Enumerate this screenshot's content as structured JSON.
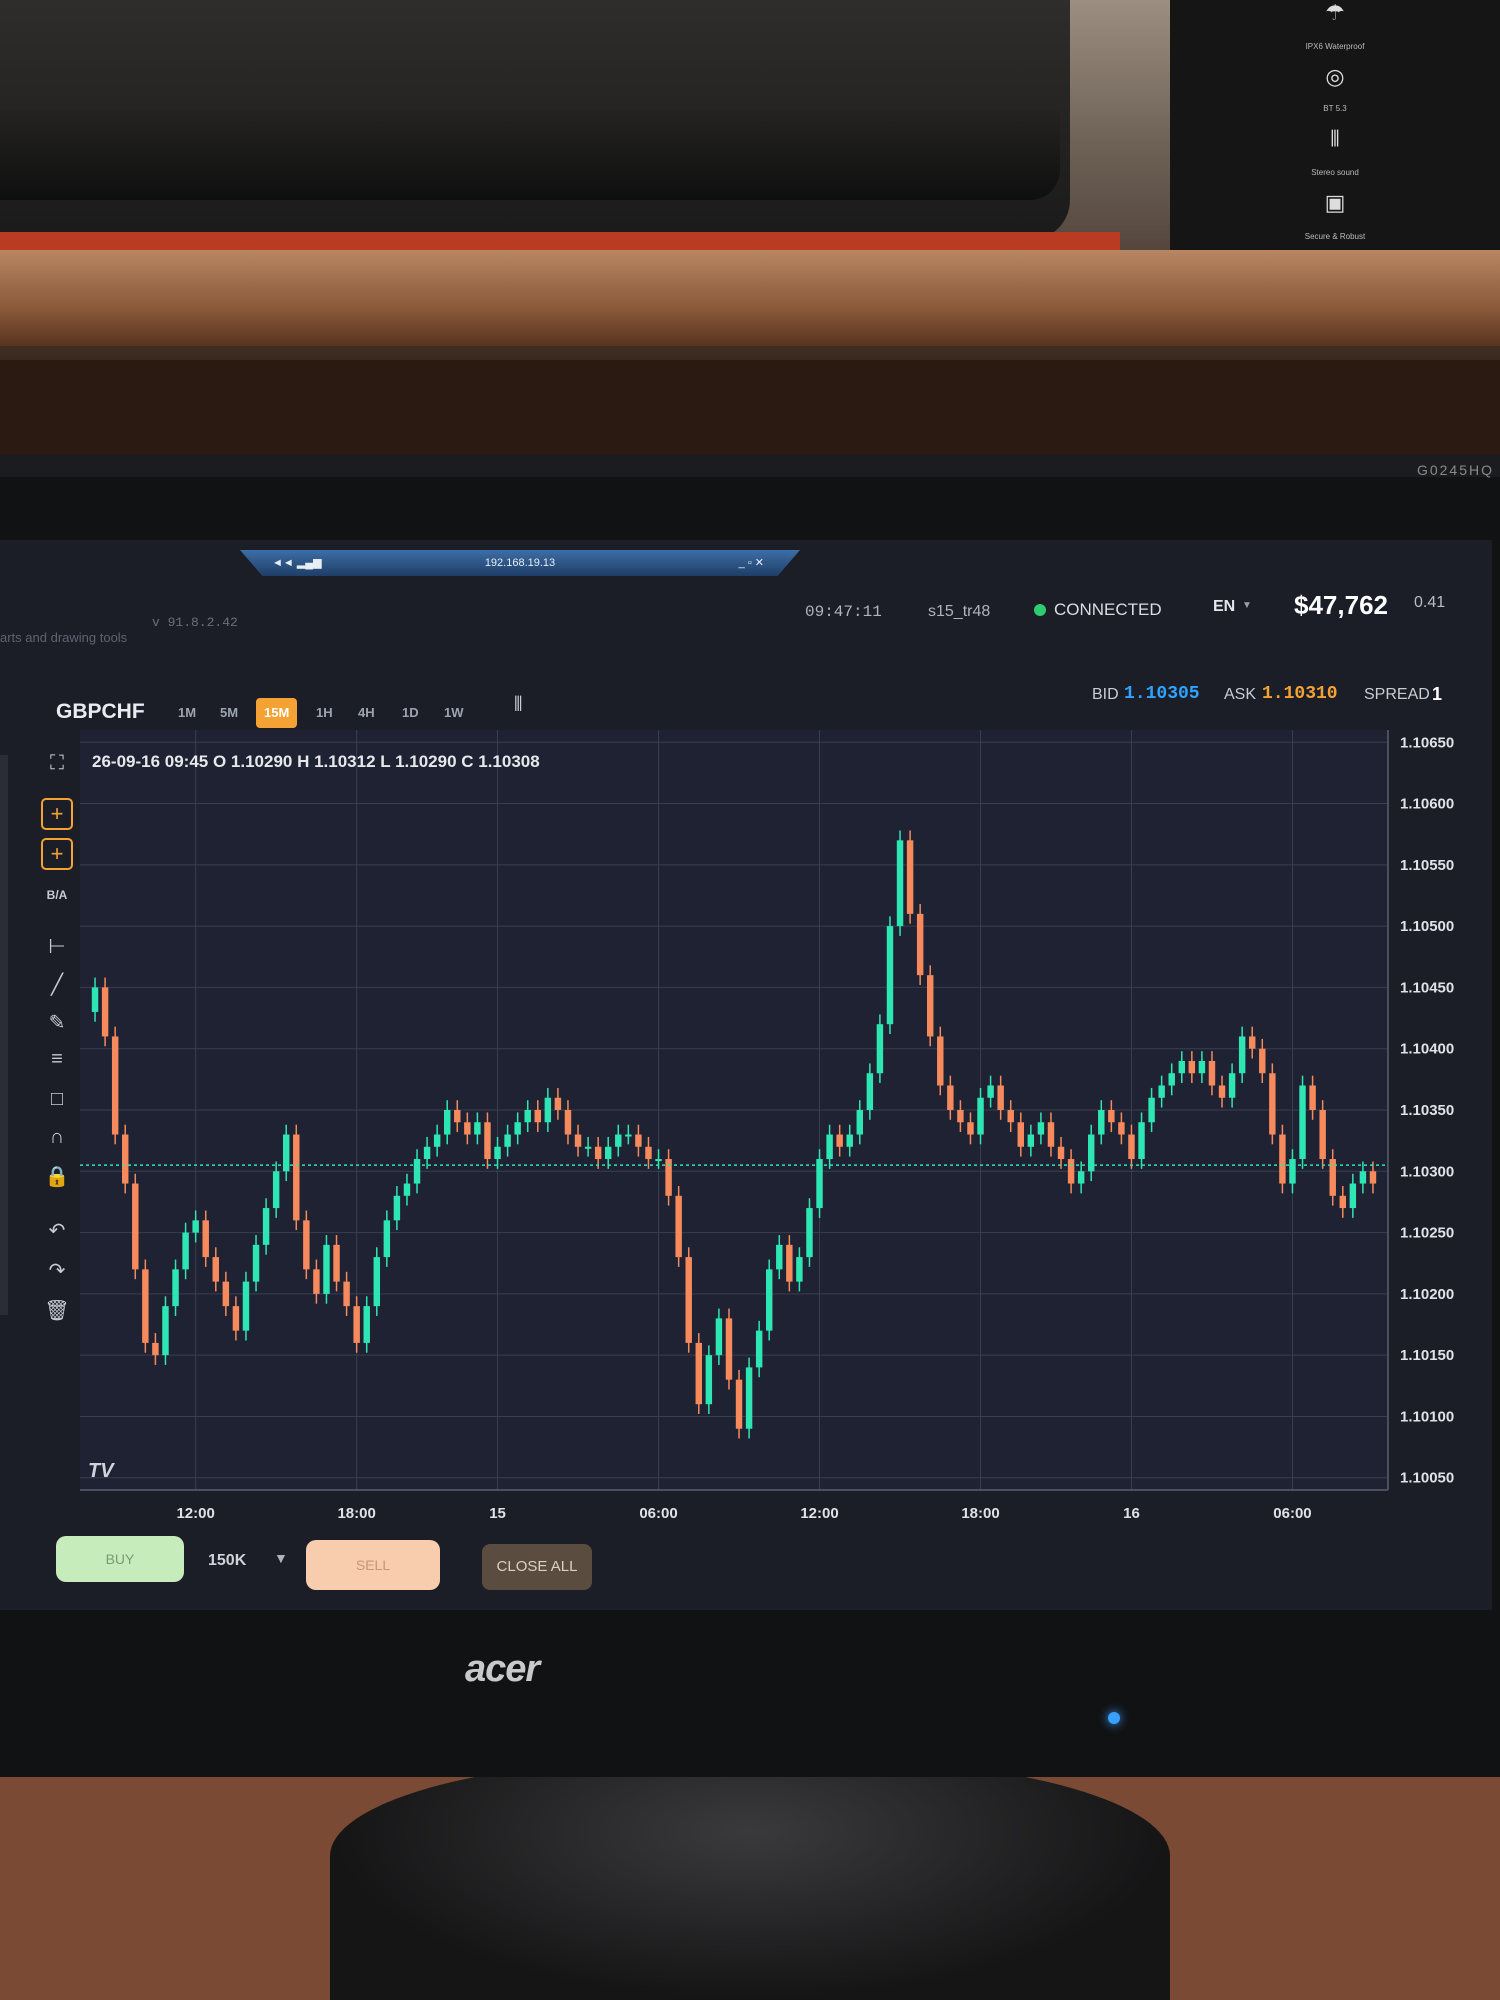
{
  "room": {
    "box_labels": [
      "IPX6 Waterproof",
      "BT 5.3",
      "Stereo sound",
      "Secure & Robust"
    ],
    "monitor_model": "G0245HQ",
    "monitor_brand": "acer"
  },
  "rdp_bar": {
    "title": "192.168.19.13",
    "left_icons": "◄◄ ▂▄▆",
    "window_icons": "_ ▫ ✕"
  },
  "header": {
    "version": "v 91.8.2.42",
    "hint": "arts and drawing tools",
    "time": "09:47:11",
    "account": "s15_tr48",
    "connection": "CONNECTED",
    "language": "EN",
    "balance": "$47,762",
    "balance_change": "0.41",
    "colors": {
      "connected": "#2ecc71",
      "accent": "#f5a235",
      "bid": "#2fa4ff"
    }
  },
  "instrument": {
    "symbol": "GBPCHF",
    "timeframes": [
      "1M",
      "5M",
      "15M",
      "1H",
      "4H",
      "1D",
      "1W"
    ],
    "active_timeframe": "15M",
    "chart_type_icon": "candlestick-icon",
    "bid_label": "BID",
    "bid": "1.10305",
    "ask_label": "ASK",
    "ask": "1.10310",
    "spread_label": "SPREAD",
    "spread": "1"
  },
  "ohlc_line": "26-09-16 09:45 O 1.10290 H 1.10312 L 1.10290 C 1.10308",
  "toolbar": [
    {
      "name": "fullscreen-icon",
      "glyph": "⛶"
    },
    {
      "name": "crosshair-icon",
      "glyph": "+"
    },
    {
      "name": "move-icon",
      "glyph": "+"
    },
    {
      "name": "bid-ask-toggle",
      "glyph": "B/A"
    },
    {
      "name": "horizontal-line-icon",
      "glyph": "⊢"
    },
    {
      "name": "trend-line-icon",
      "glyph": "╱"
    },
    {
      "name": "brush-icon",
      "glyph": "✎"
    },
    {
      "name": "fib-levels-icon",
      "glyph": "≡"
    },
    {
      "name": "rectangle-icon",
      "glyph": "□"
    },
    {
      "name": "magnet-icon",
      "glyph": "∩"
    },
    {
      "name": "lock-icon",
      "glyph": "🔒"
    },
    {
      "name": "undo-icon",
      "glyph": "↶"
    },
    {
      "name": "redo-icon",
      "glyph": "↷"
    },
    {
      "name": "trash-icon",
      "glyph": "🗑"
    }
  ],
  "chart_data": {
    "type": "candlestick",
    "colors": {
      "up": "#2ee6b4",
      "down": "#f68a5c",
      "grid": "#3a3f4f",
      "current_line": "#2ee6b4"
    },
    "x_tick_labels": [
      "12:00",
      "18:00",
      "15",
      "06:00",
      "12:00",
      "18:00",
      "16",
      "06:00"
    ],
    "y_tick_labels": [
      "1.10650",
      "1.10600",
      "1.10550",
      "1.10500",
      "1.10450",
      "1.10400",
      "1.10350",
      "1.10300",
      "1.10250",
      "1.10200",
      "1.10150",
      "1.10100",
      "1.10050"
    ],
    "ylim": [
      1.1004,
      1.1066
    ],
    "current_price": 1.10305,
    "closes": [
      1.1045,
      1.1041,
      1.1033,
      1.1029,
      1.1022,
      1.1016,
      1.1015,
      1.1019,
      1.1022,
      1.1025,
      1.1026,
      1.1023,
      1.1021,
      1.1019,
      1.1017,
      1.1021,
      1.1024,
      1.1027,
      1.103,
      1.1033,
      1.1026,
      1.1022,
      1.102,
      1.1024,
      1.1021,
      1.1019,
      1.1016,
      1.1019,
      1.1023,
      1.1026,
      1.1028,
      1.1029,
      1.1031,
      1.1032,
      1.1033,
      1.1035,
      1.1034,
      1.1033,
      1.1034,
      1.1031,
      1.1032,
      1.1033,
      1.1034,
      1.1035,
      1.1034,
      1.1036,
      1.1035,
      1.1033,
      1.1032,
      1.1032,
      1.1031,
      1.1032,
      1.1033,
      1.1033,
      1.1032,
      1.1031,
      1.1031,
      1.1028,
      1.1023,
      1.1016,
      1.1011,
      1.1015,
      1.1018,
      1.1013,
      1.1009,
      1.1014,
      1.1017,
      1.1022,
      1.1024,
      1.1021,
      1.1023,
      1.1027,
      1.1031,
      1.1033,
      1.1032,
      1.1033,
      1.1035,
      1.1038,
      1.1042,
      1.105,
      1.1057,
      1.1051,
      1.1046,
      1.1041,
      1.1037,
      1.1035,
      1.1034,
      1.1033,
      1.1036,
      1.1037,
      1.1035,
      1.1034,
      1.1032,
      1.1033,
      1.1034,
      1.1032,
      1.1031,
      1.1029,
      1.103,
      1.1033,
      1.1035,
      1.1034,
      1.1033,
      1.1031,
      1.1034,
      1.1036,
      1.1037,
      1.1038,
      1.1039,
      1.1038,
      1.1039,
      1.1037,
      1.1036,
      1.1038,
      1.1041,
      1.104,
      1.1038,
      1.1033,
      1.1029,
      1.1031,
      1.1037,
      1.1035,
      1.1031,
      1.1028,
      1.1027,
      1.1029,
      1.103,
      1.1029
    ]
  },
  "order_bar": {
    "buy": "BUY",
    "quantity": "150K",
    "sell": "SELL",
    "close_all": "CLOSE ALL"
  }
}
